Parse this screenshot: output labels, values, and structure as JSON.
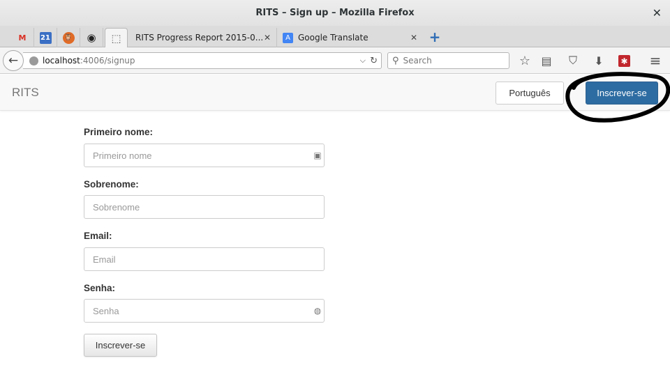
{
  "window": {
    "title": "RITS – Sign up – Mozilla Firefox",
    "close_glyph": "✕"
  },
  "tabs": {
    "pinned": [
      {
        "icon": "gmail-icon",
        "glyph": "M",
        "color": "#d93025"
      },
      {
        "icon": "calendar-icon",
        "glyph": "21",
        "color": "#3a6fc4"
      },
      {
        "icon": "owl-icon",
        "glyph": "🦉",
        "color": "#e06b27"
      },
      {
        "icon": "github-icon",
        "glyph": "◉",
        "color": "#222222"
      },
      {
        "icon": "blank-page-icon",
        "glyph": "⬚",
        "color": "#666666"
      }
    ],
    "items": [
      {
        "label": "RITS Progress Report 2015-0...",
        "close": "✕"
      },
      {
        "label": "Google Translate",
        "close": "✕"
      }
    ],
    "new_tab_glyph": "+"
  },
  "navbar": {
    "back_glyph": "←",
    "url_host": "localhost",
    "url_path": ":4006/signup",
    "dropdown_glyph": "⌵",
    "reload_glyph": "↻",
    "search_placeholder": "Search",
    "search_glyph": "⚲",
    "tools": [
      {
        "icon": "bookmark-star-icon",
        "glyph": "☆"
      },
      {
        "icon": "reading-list-icon",
        "glyph": "▤"
      },
      {
        "icon": "pocket-icon",
        "glyph": "⛉"
      },
      {
        "icon": "download-icon",
        "glyph": "⬇"
      },
      {
        "icon": "addon-icon",
        "glyph": "✱"
      },
      {
        "icon": "menu-icon",
        "glyph": "≡"
      }
    ]
  },
  "app": {
    "brand": "RITS",
    "language_button": "Português",
    "signup_button": "Inscrever-se",
    "accent_color": "#2d6ca2"
  },
  "form": {
    "first_name": {
      "label": "Primeiro nome:",
      "placeholder": "Primeiro nome",
      "icon": "contact-card-icon",
      "glyph": "▣"
    },
    "last_name": {
      "label": "Sobrenome:",
      "placeholder": "Sobrenome"
    },
    "email": {
      "label": "Email:",
      "placeholder": "Email"
    },
    "password": {
      "label": "Senha:",
      "placeholder": "Senha",
      "icon": "password-key-icon",
      "glyph": "◍"
    },
    "submit": "Inscrever-se"
  }
}
